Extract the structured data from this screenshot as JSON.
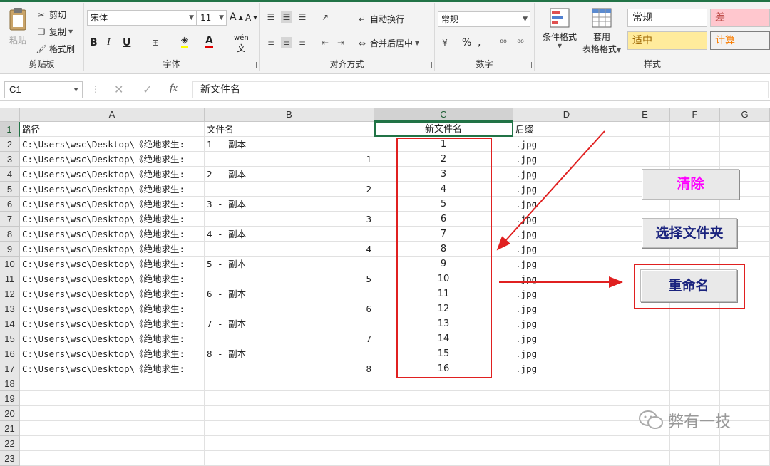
{
  "ribbon": {
    "clipboard": {
      "paste": "粘贴",
      "cut": "剪切",
      "copy": "复制",
      "format_painter": "格式刷",
      "group": "剪贴板"
    },
    "font": {
      "name": "宋体",
      "size": "11",
      "bold": "B",
      "italic": "I",
      "underline": "U",
      "group": "字体",
      "phonetic": "wén"
    },
    "alignment": {
      "wrap": "自动换行",
      "merge": "合并后居中",
      "group": "对齐方式"
    },
    "number": {
      "format": "常规",
      "percent": "%",
      "comma": ",",
      "group": "数字"
    },
    "styles": {
      "cond_format": "条件格式",
      "table_format_1": "套用",
      "table_format_2": "表格格式",
      "normal": "常规",
      "bad": "差",
      "neutral": "适中",
      "calc": "计算",
      "group": "样式"
    }
  },
  "formula_bar": {
    "name_box": "C1",
    "fx": "fx",
    "content": "新文件名"
  },
  "columns": [
    "A",
    "B",
    "C",
    "D",
    "E",
    "F",
    "G"
  ],
  "rows": [
    {
      "n": "1",
      "a": "路径",
      "b": "文件名",
      "b_num": "",
      "c": "新文件名",
      "d": "后缀"
    },
    {
      "n": "2",
      "a": "C:\\Users\\wsc\\Desktop\\《绝地求生:",
      "b": "1 - 副本",
      "b_num": "",
      "c": "1",
      "d": ".jpg"
    },
    {
      "n": "3",
      "a": "C:\\Users\\wsc\\Desktop\\《绝地求生:",
      "b": "",
      "b_num": "1",
      "c": "2",
      "d": ".jpg"
    },
    {
      "n": "4",
      "a": "C:\\Users\\wsc\\Desktop\\《绝地求生:",
      "b": "2 - 副本",
      "b_num": "",
      "c": "3",
      "d": ".jpg"
    },
    {
      "n": "5",
      "a": "C:\\Users\\wsc\\Desktop\\《绝地求生:",
      "b": "",
      "b_num": "2",
      "c": "4",
      "d": ".jpg"
    },
    {
      "n": "6",
      "a": "C:\\Users\\wsc\\Desktop\\《绝地求生:",
      "b": "3 - 副本",
      "b_num": "",
      "c": "5",
      "d": ".jpg"
    },
    {
      "n": "7",
      "a": "C:\\Users\\wsc\\Desktop\\《绝地求生:",
      "b": "",
      "b_num": "3",
      "c": "6",
      "d": ".jpg"
    },
    {
      "n": "8",
      "a": "C:\\Users\\wsc\\Desktop\\《绝地求生:",
      "b": "4 - 副本",
      "b_num": "",
      "c": "7",
      "d": ".jpg"
    },
    {
      "n": "9",
      "a": "C:\\Users\\wsc\\Desktop\\《绝地求生:",
      "b": "",
      "b_num": "4",
      "c": "8",
      "d": ".jpg"
    },
    {
      "n": "10",
      "a": "C:\\Users\\wsc\\Desktop\\《绝地求生:",
      "b": "5 - 副本",
      "b_num": "",
      "c": "9",
      "d": ".jpg"
    },
    {
      "n": "11",
      "a": "C:\\Users\\wsc\\Desktop\\《绝地求生:",
      "b": "",
      "b_num": "5",
      "c": "10",
      "d": ".jpg"
    },
    {
      "n": "12",
      "a": "C:\\Users\\wsc\\Desktop\\《绝地求生:",
      "b": "6 - 副本",
      "b_num": "",
      "c": "11",
      "d": ".jpg"
    },
    {
      "n": "13",
      "a": "C:\\Users\\wsc\\Desktop\\《绝地求生:",
      "b": "",
      "b_num": "6",
      "c": "12",
      "d": ".jpg"
    },
    {
      "n": "14",
      "a": "C:\\Users\\wsc\\Desktop\\《绝地求生:",
      "b": "7 - 副本",
      "b_num": "",
      "c": "13",
      "d": ".jpg"
    },
    {
      "n": "15",
      "a": "C:\\Users\\wsc\\Desktop\\《绝地求生:",
      "b": "",
      "b_num": "7",
      "c": "14",
      "d": ".jpg"
    },
    {
      "n": "16",
      "a": "C:\\Users\\wsc\\Desktop\\《绝地求生:",
      "b": "8 - 副本",
      "b_num": "",
      "c": "15",
      "d": ".jpg"
    },
    {
      "n": "17",
      "a": "C:\\Users\\wsc\\Desktop\\《绝地求生:",
      "b": "",
      "b_num": "8",
      "c": "16",
      "d": ".jpg"
    },
    {
      "n": "18",
      "a": "",
      "b": "",
      "b_num": "",
      "c": "",
      "d": ""
    },
    {
      "n": "19",
      "a": "",
      "b": "",
      "b_num": "",
      "c": "",
      "d": ""
    },
    {
      "n": "20",
      "a": "",
      "b": "",
      "b_num": "",
      "c": "",
      "d": ""
    },
    {
      "n": "21",
      "a": "",
      "b": "",
      "b_num": "",
      "c": "",
      "d": ""
    },
    {
      "n": "22",
      "a": "",
      "b": "",
      "b_num": "",
      "c": "",
      "d": ""
    },
    {
      "n": "23",
      "a": "",
      "b": "",
      "b_num": "",
      "c": "",
      "d": ""
    }
  ],
  "buttons": {
    "clear": "清除",
    "select_folder": "选择文件夹",
    "rename": "重命名"
  },
  "watermark": "弊有一技",
  "colors": {
    "accent": "#217346",
    "highlight": "#e02020",
    "clear_text": "#ff00ff",
    "button_text": "#1a237e"
  }
}
